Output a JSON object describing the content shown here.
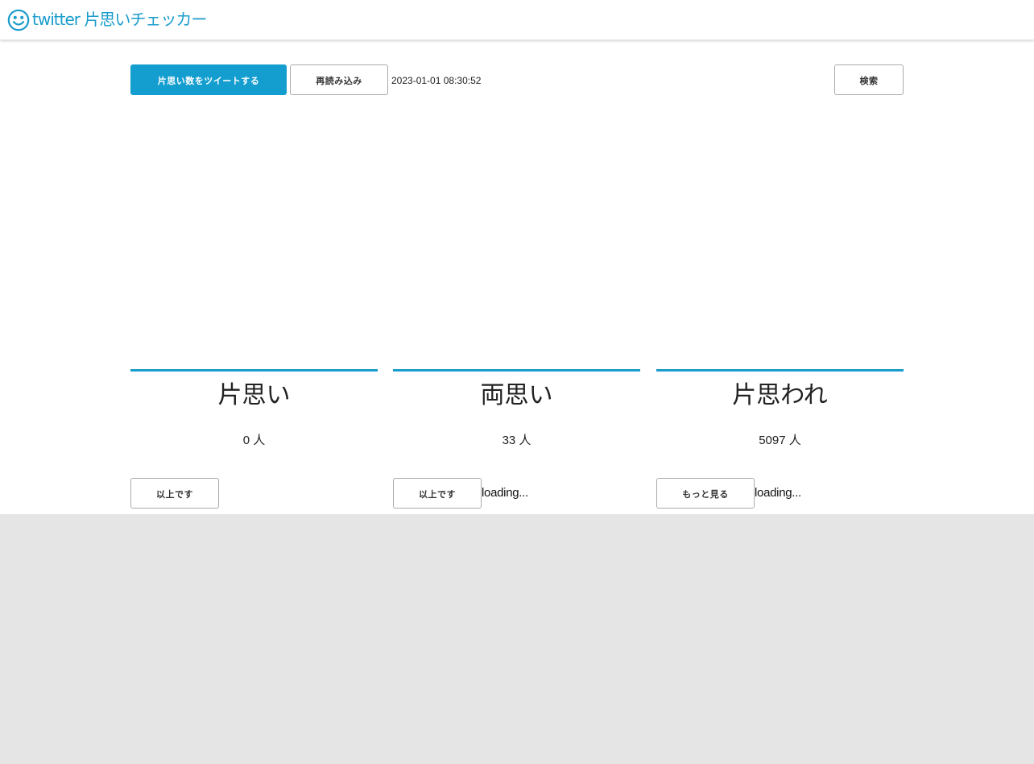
{
  "header": {
    "brand_icon": "smiley-face-icon",
    "brand_text": "twitter 片思いチェッカー",
    "accent_color": "#1a9ccc"
  },
  "toolbar": {
    "tweet_button_label": "片思い数をツイートする",
    "reload_button_label": "再読み込み",
    "timestamp": "2023-01-01 08:30:52",
    "search_button_label": "検索"
  },
  "columns": [
    {
      "title": "片思い",
      "count": "0 人",
      "button_label": "以上です",
      "status": ""
    },
    {
      "title": "両思い",
      "count": "33 人",
      "button_label": "以上です",
      "status": "loading..."
    },
    {
      "title": "片思われ",
      "count": "5097 人",
      "button_label": "もっと見る",
      "status": "loading..."
    }
  ]
}
